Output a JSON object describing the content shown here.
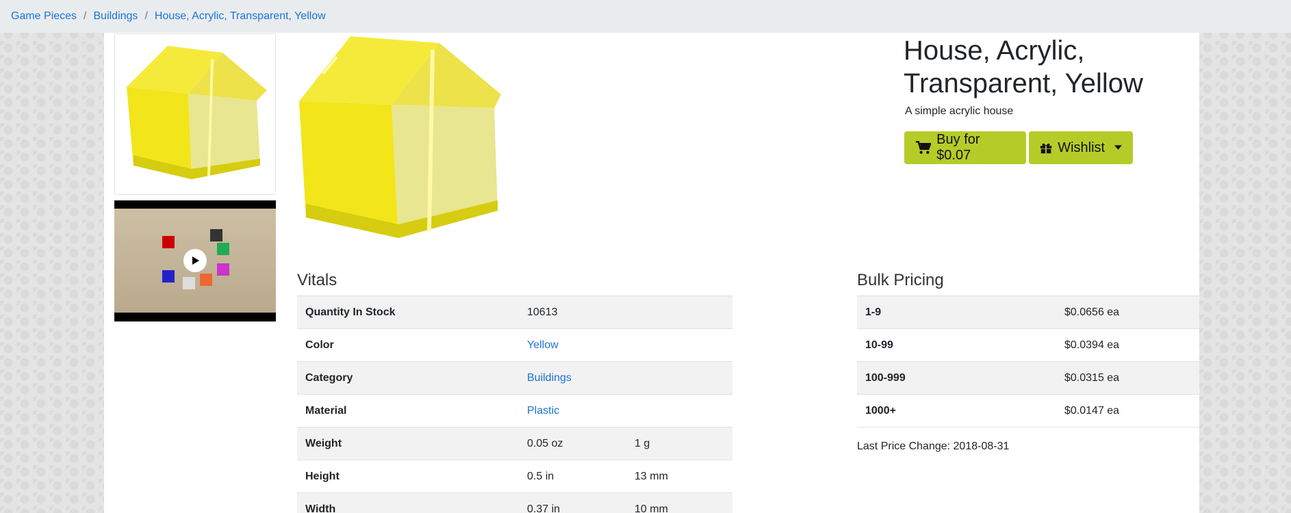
{
  "breadcrumb": [
    "Game Pieces",
    "Buildings",
    "House, Acrylic, Transparent, Yellow"
  ],
  "product": {
    "title": "House, Acrylic, Transparent, Yellow",
    "subtitle": "A simple acrylic house",
    "buy_label": "Buy for $0.07",
    "wishlist_label": "Wishlist"
  },
  "vitals": {
    "heading": "Vitals",
    "rows": [
      {
        "label": "Quantity In Stock",
        "value": "10613",
        "extra": ""
      },
      {
        "label": "Color",
        "value": "Yellow",
        "extra": ""
      },
      {
        "label": "Category",
        "value": "Buildings",
        "extra": ""
      },
      {
        "label": "Material",
        "value": "Plastic",
        "extra": ""
      },
      {
        "label": "Weight",
        "value": "0.05 oz",
        "extra": "1 g"
      },
      {
        "label": "Height",
        "value": "0.5 in",
        "extra": "13 mm"
      },
      {
        "label": "Width",
        "value": "0.37 in",
        "extra": "10 mm"
      }
    ]
  },
  "bulk": {
    "heading": "Bulk Pricing",
    "rows": [
      {
        "qty": "1-9",
        "price": "$0.0656 ea"
      },
      {
        "qty": "10-99",
        "price": "$0.0394 ea"
      },
      {
        "qty": "100-999",
        "price": "$0.0315 ea"
      },
      {
        "qty": "1000+",
        "price": "$0.0147 ea"
      }
    ],
    "last_change": "Last Price Change: 2018-08-31"
  },
  "colors": {
    "accent": "#b5cc28",
    "link": "#1a73d9",
    "piece": "#f2e51a"
  },
  "icons": [
    "cart-icon",
    "gift-icon",
    "caret-down-icon",
    "play-icon"
  ]
}
